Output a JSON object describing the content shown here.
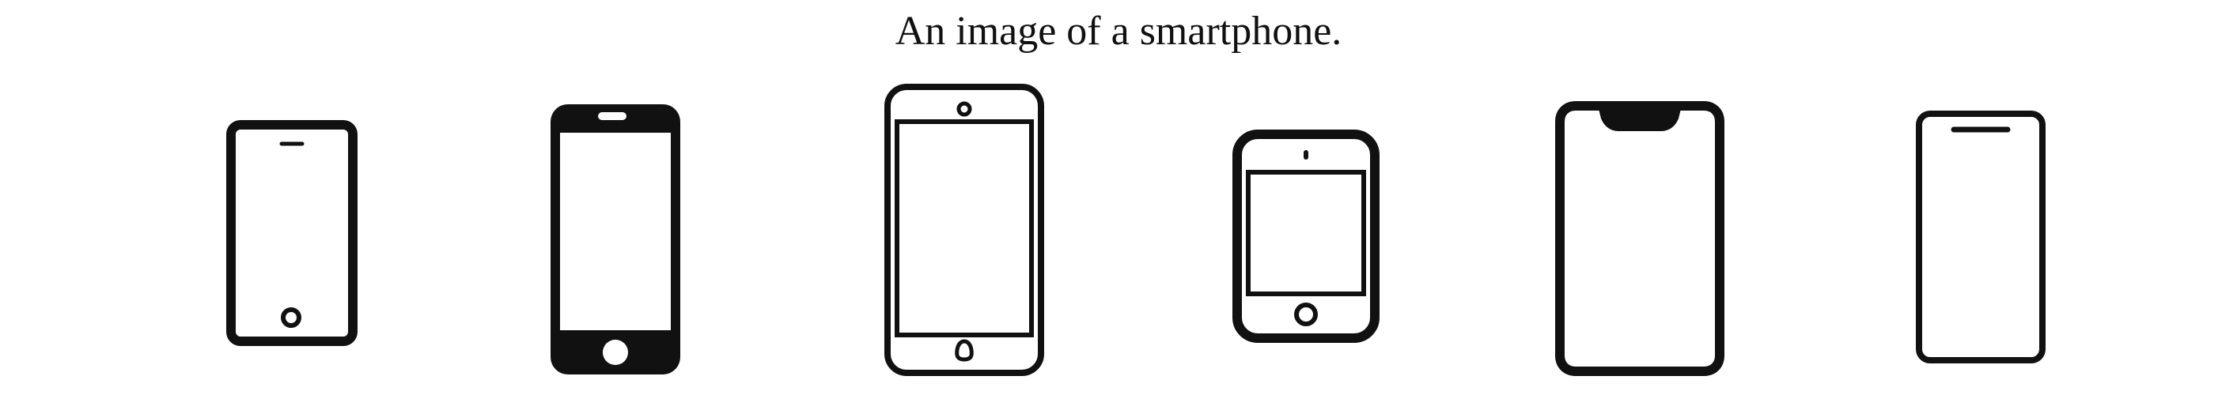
{
  "caption": "An image of a smartphone.",
  "icons": [
    {
      "name": "smartphone-icon-1"
    },
    {
      "name": "smartphone-icon-2"
    },
    {
      "name": "smartphone-icon-3"
    },
    {
      "name": "tablet-icon-4"
    },
    {
      "name": "smartphone-notch-icon-5"
    },
    {
      "name": "smartphone-icon-6"
    }
  ],
  "colors": {
    "ink": "#111111",
    "background": "#ffffff"
  }
}
